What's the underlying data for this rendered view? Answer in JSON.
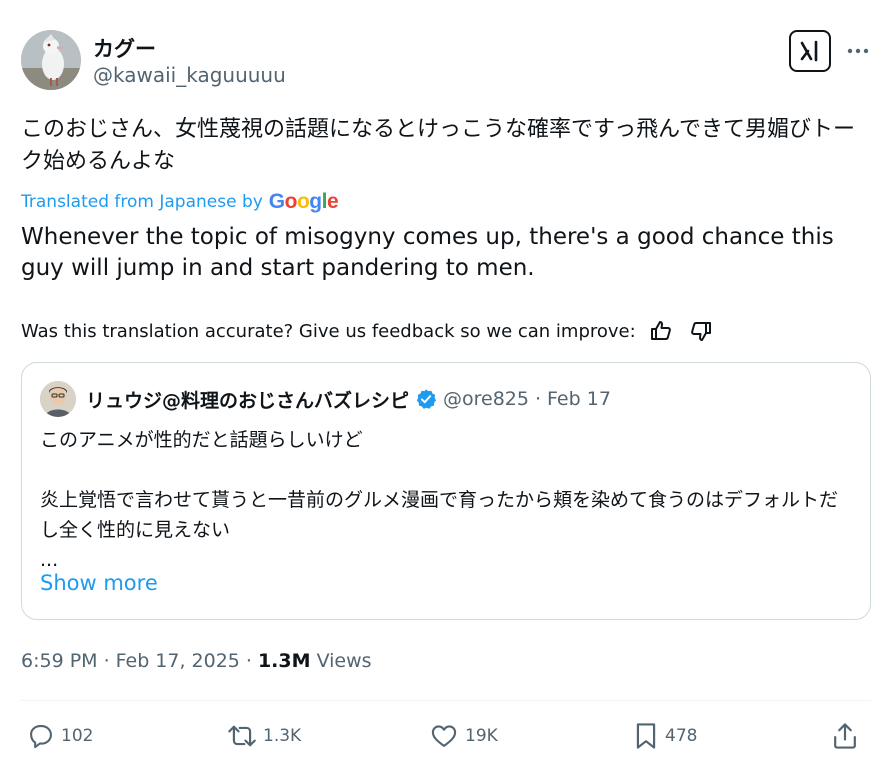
{
  "author": {
    "display_name": "カグー",
    "handle": "@kawaii_kaguuuuu"
  },
  "tweet": {
    "text": "このおじさん、女性蔑視の話題になるとけっこうな確率ですっ飛んできて男媚びトーク始めるんよな",
    "translated_label": "Translated from Japanese by",
    "google_label": "Google",
    "translation": "Whenever the topic of misogyny comes up, there's a good chance this guy will jump in and start pandering to men.",
    "feedback_prompt": "Was this translation accurate? Give us feedback so we can improve:"
  },
  "quote": {
    "display_name": "リュウジ@料理のおじさんバズレシピ",
    "handle": "@ore825",
    "separator": "·",
    "date": "Feb 17",
    "text": "このアニメが性的だと話題らしいけど\n\n炎上覚悟で言わせて貰うと一昔前のグルメ漫画で育ったから頬を染めて食うのはデフォルトだし全く性的に見えない\n...",
    "show_more": "Show more"
  },
  "meta": {
    "time": "6:59 PM",
    "dot1": "·",
    "date": "Feb 17, 2025",
    "dot2": "·",
    "views_count": "1.3M",
    "views_label": "Views"
  },
  "actions": {
    "replies": "102",
    "reposts": "1.3K",
    "likes": "19K",
    "bookmarks": "478"
  },
  "icons": {
    "grok": "grok-icon",
    "more": "more-icon",
    "thumbs_up": "thumbs-up-icon",
    "thumbs_down": "thumbs-down-icon",
    "verified": "verified-badge-icon",
    "reply": "reply-icon",
    "repost": "repost-icon",
    "like": "heart-icon",
    "bookmark": "bookmark-icon",
    "share": "share-icon"
  },
  "colors": {
    "link": "#1d9bf0",
    "text": "#0f1419",
    "secondary": "#536471",
    "border": "#cfd9de",
    "verified": "#1d9bf0"
  }
}
